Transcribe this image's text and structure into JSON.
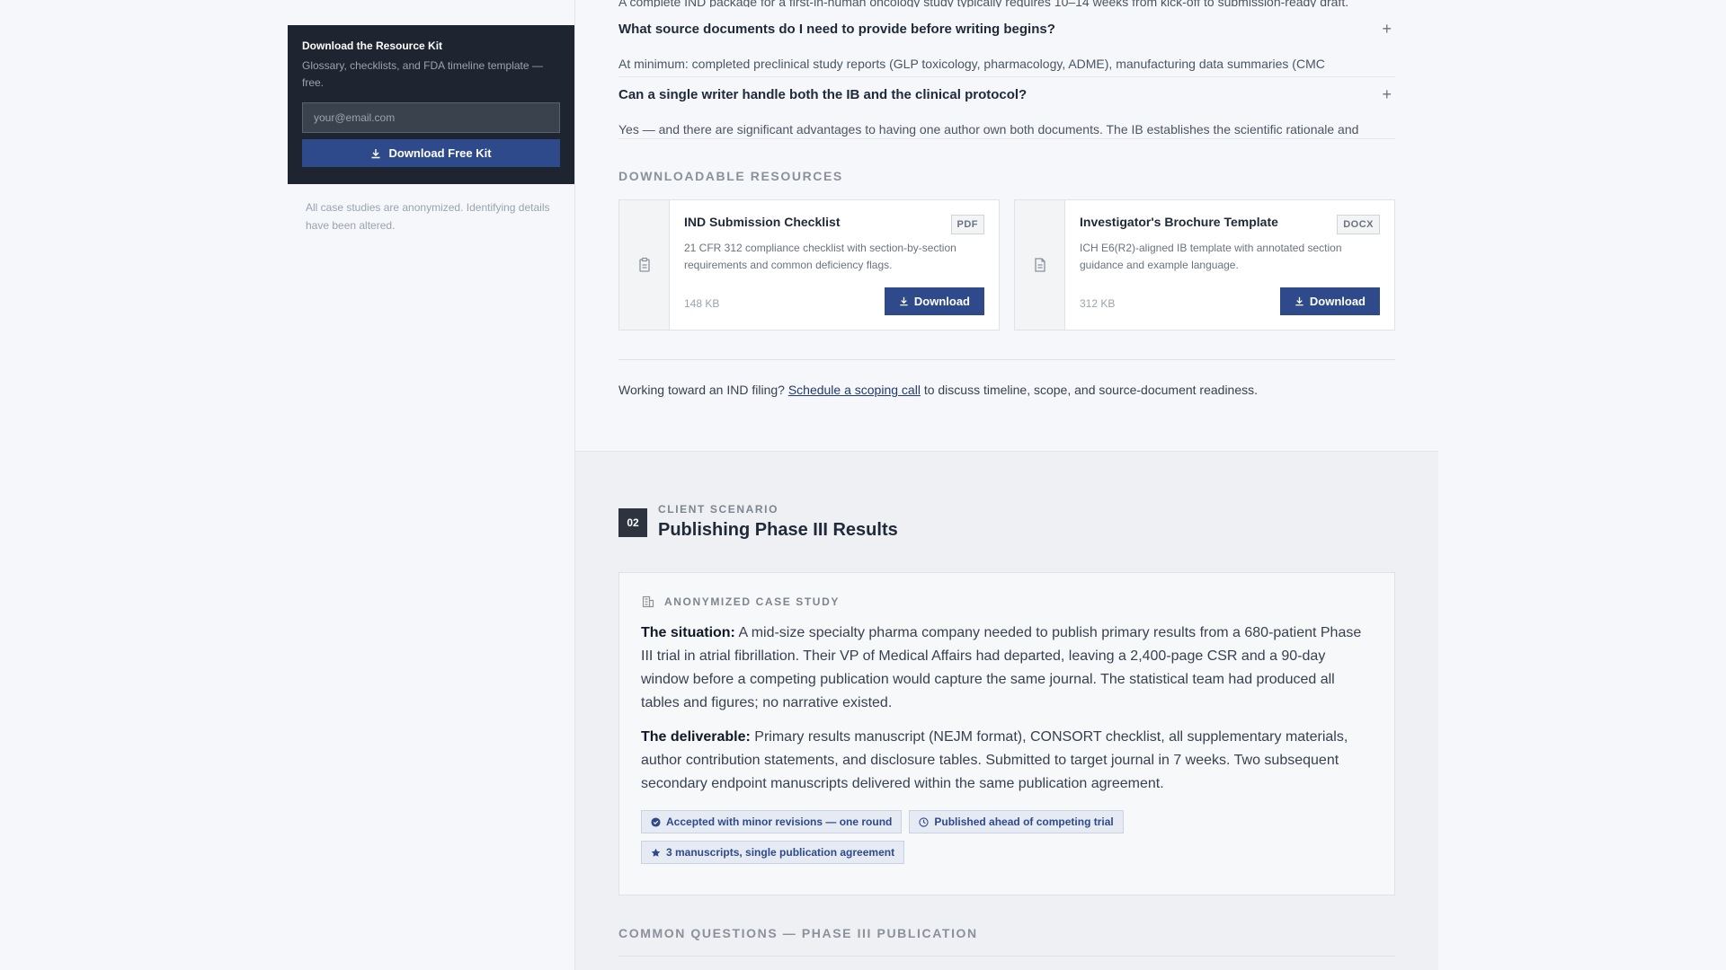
{
  "sidebar": {
    "kit_title": "Download the Resource Kit",
    "kit_desc": "Glossary, checklists, and FDA timeline template — free.",
    "email_placeholder": "your@email.com",
    "kit_button": "Download Free Kit",
    "note": "All case studies are anonymized. Identifying details have been altered."
  },
  "faq": {
    "cut_line": "A complete IND package for a first-in-human oncology study typically requires 10–14 weeks from kick-off to submission-ready draft.",
    "items": [
      {
        "question": "What source documents do I need to provide before writing begins?",
        "answer": "At minimum: completed preclinical study reports (GLP toxicology, pharmacology, ADME), manufacturing data summaries (CMC"
      },
      {
        "question": "Can a single writer handle both the IB and the clinical protocol?",
        "answer": "Yes — and there are significant advantages to having one author own both documents. The IB establishes the scientific rationale and"
      }
    ],
    "plus_icon": "+"
  },
  "resources": {
    "label": "DOWNLOADABLE RESOURCES",
    "cards": [
      {
        "title": "IND Submission Checklist",
        "badge": "PDF",
        "desc": "21 CFR 312 compliance checklist with section-by-section requirements and common deficiency flags.",
        "size": "148 KB",
        "button": "Download",
        "icon": "clipboard-icon"
      },
      {
        "title": "Investigator's Brochure Template",
        "badge": "DOCX",
        "desc": "ICH E6(R2)-aligned IB template with annotated section guidance and example language.",
        "size": "312 KB",
        "button": "Download",
        "icon": "document-icon"
      }
    ]
  },
  "cta": {
    "before": "Working toward an IND filing?",
    "link": "Schedule a scoping call",
    "after": "to discuss timeline, scope, and source-document readiness."
  },
  "scenario": {
    "number": "02",
    "kicker": "CLIENT SCENARIO",
    "title": "Publishing Phase III Results",
    "case_label": "ANONYMIZED CASE STUDY",
    "situation_label": "The situation:",
    "situation_text": "A mid-size specialty pharma company needed to publish primary results from a 680-patient Phase III trial in atrial fibrillation. Their VP of Medical Affairs had departed, leaving a 2,400-page CSR and a 90-day window before a competing publication would capture the same journal. The statistical team had produced all tables and figures; no narrative existed.",
    "deliverable_label": "The deliverable:",
    "deliverable_text": "Primary results manuscript (NEJM format), CONSORT checklist, all supplementary materials, author contribution statements, and disclosure tables. Submitted to target journal in 7 weeks. Two subsequent secondary endpoint manuscripts delivered within the same publication agreement.",
    "tags": [
      {
        "label": "Accepted with minor revisions — one round",
        "icon": "check-circle-icon"
      },
      {
        "label": "Published ahead of competing trial",
        "icon": "clock-icon"
      },
      {
        "label": "3 manuscripts, single publication agreement",
        "icon": "star-icon"
      }
    ]
  },
  "faq2": {
    "label": "COMMON QUESTIONS — PHASE III PUBLICATION"
  },
  "colors": {
    "accent": "#2e4a8b",
    "dark_card": "#1e2530",
    "page_bg": "#f5f7fa"
  }
}
